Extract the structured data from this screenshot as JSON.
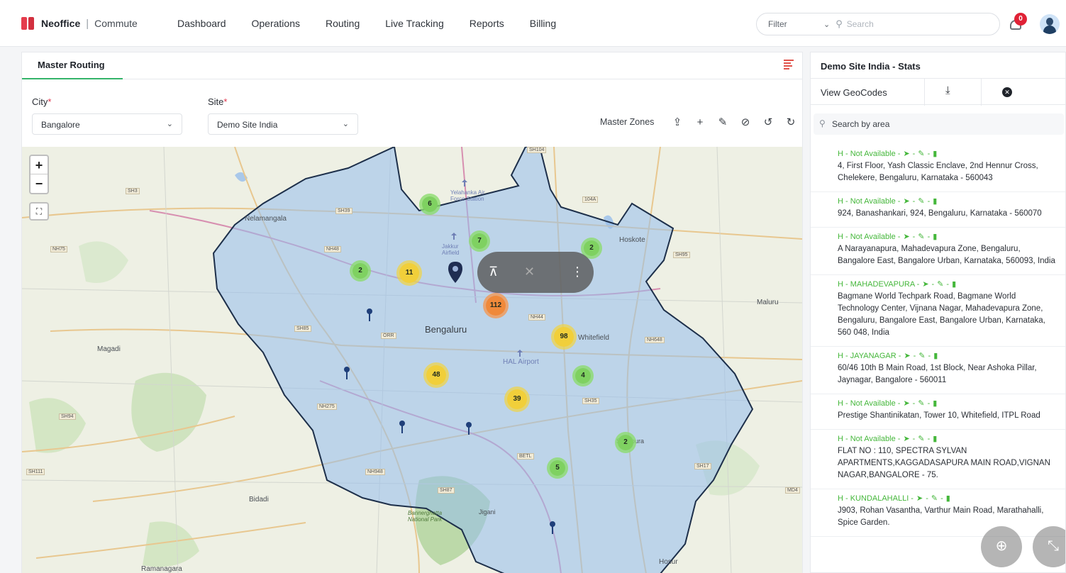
{
  "brand": {
    "name": "Neoffice",
    "separator": "|",
    "product": "Commute"
  },
  "nav": [
    "Dashboard",
    "Operations",
    "Routing",
    "Live Tracking",
    "Reports",
    "Billing"
  ],
  "topbar": {
    "filter_label": "Filter",
    "search_placeholder": "Search",
    "notification_count": "0"
  },
  "main": {
    "tab": "Master Routing",
    "city_label": "City",
    "city_value": "Bangalore",
    "site_label": "Site",
    "site_value": "Demo Site India",
    "required_mark": "*",
    "master_zones_label": "Master Zones",
    "toolbar_icons": [
      "upload-icon",
      "add-icon",
      "edit-icon",
      "hide-icon",
      "history-icon",
      "refresh-icon"
    ]
  },
  "map": {
    "zoom_in": "+",
    "zoom_out": "−",
    "place_labels": {
      "nelamangala": "Nelamangala",
      "bengaluru": "Bengaluru",
      "magadi": "Magadi",
      "whitefield": "Whitefield",
      "hoskote": "Hoskote",
      "maluru": "Maluru",
      "bidadi": "Bidadi",
      "hosur": "Hosur",
      "ramanagara": "Ramanagara",
      "hal_airport": "HAL Airport",
      "yelahanka_station": "Yelahanka Air Force Station",
      "jakkur": "Jakkur Airfield",
      "bannerghatta": "Bannerghatta National Park",
      "jigani": "Jigani",
      "sarjapura": "Sarjapura"
    },
    "road_tags": [
      "SH3",
      "NH75",
      "SH39",
      "NH48",
      "SH85",
      "ORR",
      "NH275",
      "SH94",
      "SH111",
      "NH948",
      "SH87",
      "BETL",
      "NH44",
      "SH35",
      "NH648",
      "SH95",
      "SH17",
      "SH104",
      "104A",
      "MD4",
      "NH648"
    ],
    "clusters": [
      {
        "id": "c6",
        "count": "6",
        "color": "green"
      },
      {
        "id": "c7",
        "count": "7",
        "color": "green"
      },
      {
        "id": "c2a",
        "count": "2",
        "color": "green"
      },
      {
        "id": "c2b",
        "count": "2",
        "color": "green"
      },
      {
        "id": "c11",
        "count": "11",
        "color": "yellow"
      },
      {
        "id": "c112",
        "count": "112",
        "color": "orange"
      },
      {
        "id": "c98",
        "count": "98",
        "color": "yellow"
      },
      {
        "id": "c4",
        "count": "4",
        "color": "green"
      },
      {
        "id": "c48",
        "count": "48",
        "color": "yellow"
      },
      {
        "id": "c39",
        "count": "39",
        "color": "yellow"
      },
      {
        "id": "c2c",
        "count": "2",
        "color": "green"
      },
      {
        "id": "c5",
        "count": "5",
        "color": "green"
      }
    ]
  },
  "panel": {
    "title": "Demo Site India - Stats",
    "view_geocodes": "View GeoCodes",
    "search_placeholder": "Search by area",
    "items": [
      {
        "head": "H - Not Available -",
        "address": "4, First Floor, Yash Classic Enclave, 2nd Hennur Cross, Chelekere, Bengaluru, Karnataka - 560043"
      },
      {
        "head": "H - Not Available -",
        "address": "924, Banashankari, 924, Bengaluru, Karnataka - 560070"
      },
      {
        "head": "H - Not Available -",
        "address": "A Narayanapura, Mahadevapura Zone, Bengaluru, Bangalore East, Bangalore Urban, Karnataka, 560093, India"
      },
      {
        "head": "H - MAHADEVAPURA -",
        "address": "Bagmane World Techpark Road, Bagmane World Technology Center, Vijnana Nagar, Mahadevapura Zone, Bengaluru, Bangalore East, Bangalore Urban, Karnataka, 560 048, India"
      },
      {
        "head": "H - JAYANAGAR -",
        "address": "60/46 10th B Main Road, 1st Block, Near Ashoka Pillar, Jaynagar, Bangalore - 560011"
      },
      {
        "head": "H - Not Available -",
        "address": "Prestige Shantinikatan, Tower 10, Whitefield, ITPL Road"
      },
      {
        "head": "H - Not Available -",
        "address": "FLAT NO : 110, SPECTRA SYLVAN APARTMENTS,KAGGADASAPURA MAIN ROAD,VIGNAN NAGAR,BANGALORE - 75."
      },
      {
        "head": "H - KUNDALAHALLI -",
        "address": "J903, Rohan Vasantha, Varthur Main Road, Marathahalli, Spice Garden."
      }
    ]
  },
  "colors": {
    "accent_green": "#34b46a",
    "zone_fill": "#b9d2ef",
    "zone_stroke": "#1d2f4a",
    "status_green": "#45b73b",
    "badge_red": "#e02236"
  }
}
